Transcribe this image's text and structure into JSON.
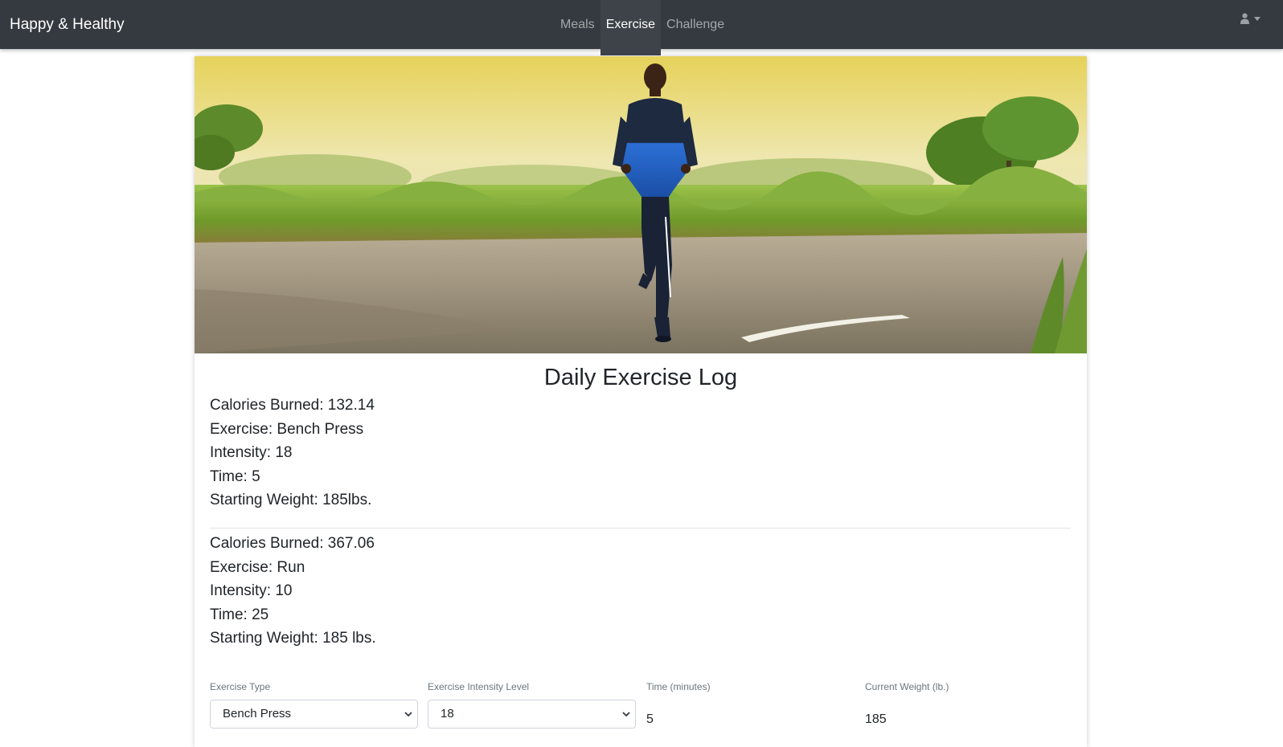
{
  "navbar": {
    "brand": "Happy & Healthy",
    "links": [
      {
        "label": "Meals",
        "active": false
      },
      {
        "label": "Exercise",
        "active": true
      },
      {
        "label": "Challenge",
        "active": false
      }
    ],
    "user_icon": "user-icon",
    "caret_icon": "caret-down-icon",
    "colors": {
      "background": "#343a40",
      "active_tab": "#3d4349"
    }
  },
  "hero": {
    "image": "runner-on-road-photo"
  },
  "log": {
    "title": "Daily Exercise Log",
    "entries": [
      {
        "calories": "Calories Burned: 132.14",
        "exercise": "Exercise: Bench Press",
        "intensity": "Intensity: 18",
        "time": "Time: 5",
        "weight": "Starting Weight: 185lbs."
      },
      {
        "calories": "Calories Burned: 367.06",
        "exercise": "Exercise: Run",
        "intensity": "Intensity: 10",
        "time": "Time: 25",
        "weight": "Starting Weight: 185 lbs."
      }
    ]
  },
  "form": {
    "exercise_type": {
      "label": "Exercise Type",
      "value": "Bench Press"
    },
    "intensity": {
      "label": "Exercise Intensity Level",
      "value": "18"
    },
    "time": {
      "label": "Time (minutes)",
      "value": "5"
    },
    "weight": {
      "label": "Current Weight (lb.)",
      "value": "185"
    }
  }
}
